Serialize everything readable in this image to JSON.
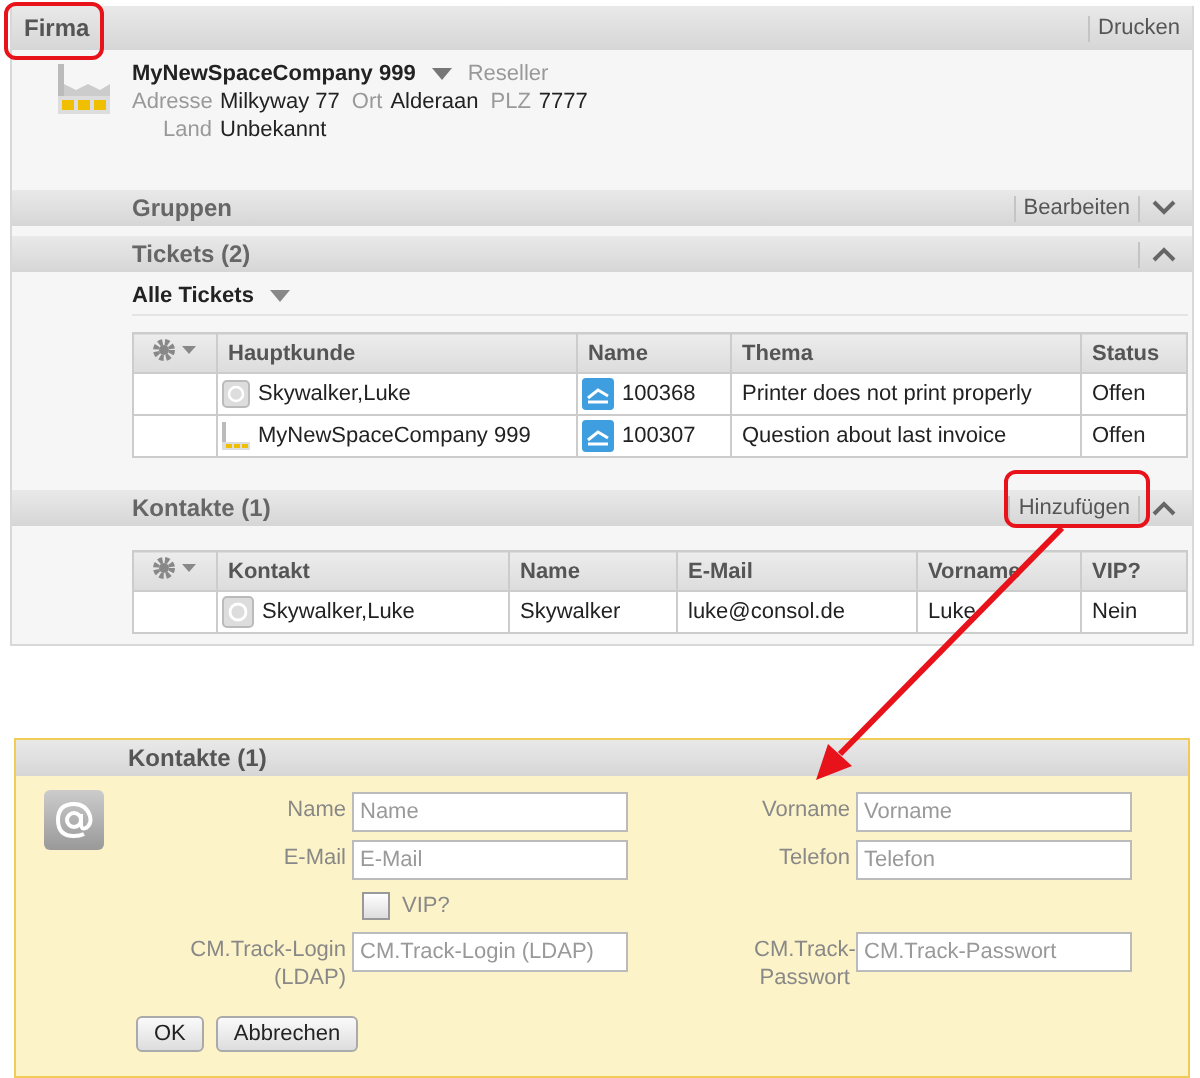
{
  "firma": {
    "title": "Firma",
    "action": "Drucken",
    "company": "MyNewSpaceCompany 999",
    "type": "Reseller",
    "fields": [
      {
        "label": "Adresse",
        "value": "Milkyway 77"
      },
      {
        "label": "Ort",
        "value": "Alderaan"
      },
      {
        "label": "PLZ",
        "value": "7777"
      }
    ],
    "land": {
      "label": "Land",
      "value": "Unbekannt"
    }
  },
  "gruppen": {
    "title": "Gruppen",
    "action": "Bearbeiten",
    "expanded": false
  },
  "tickets": {
    "title": "Tickets (2)",
    "expanded": true,
    "filter": "Alle Tickets",
    "columns": [
      "Hauptkunde",
      "Name",
      "Thema",
      "Status"
    ],
    "rows": [
      {
        "kind": "person",
        "customer": "Skywalker,Luke",
        "name": "100368",
        "topic": "Printer does not print properly",
        "status": "Offen"
      },
      {
        "kind": "company",
        "customer": "MyNewSpaceCompany 999",
        "name": "100307",
        "topic": "Question about last invoice",
        "status": "Offen"
      }
    ]
  },
  "kontakte": {
    "title": "Kontakte (1)",
    "action": "Hinzufügen",
    "expanded": true,
    "columns": [
      "Kontakt",
      "Name",
      "E-Mail",
      "Vorname",
      "VIP?"
    ],
    "rows": [
      {
        "contact": "Skywalker,Luke",
        "name": "Skywalker",
        "email": "luke@consol.de",
        "firstname": "Luke",
        "vip": "Nein"
      }
    ]
  },
  "form": {
    "title": "Kontakte (1)",
    "fields": [
      {
        "label": "Name",
        "placeholder": "Name"
      },
      {
        "label": "Vorname",
        "placeholder": "Vorname"
      },
      {
        "label": "E-Mail",
        "placeholder": "E-Mail"
      },
      {
        "label": "Telefon",
        "placeholder": "Telefon"
      }
    ],
    "vip": {
      "label": "VIP?",
      "checked": false
    },
    "login_fields": [
      {
        "label": "CM.Track-Login (LDAP)",
        "placeholder": "CM.Track-Login (LDAP)"
      },
      {
        "label": "CM.Track-Passwort",
        "placeholder": "CM.Track-Passwort"
      }
    ],
    "buttons": [
      "OK",
      "Abbrechen"
    ]
  }
}
